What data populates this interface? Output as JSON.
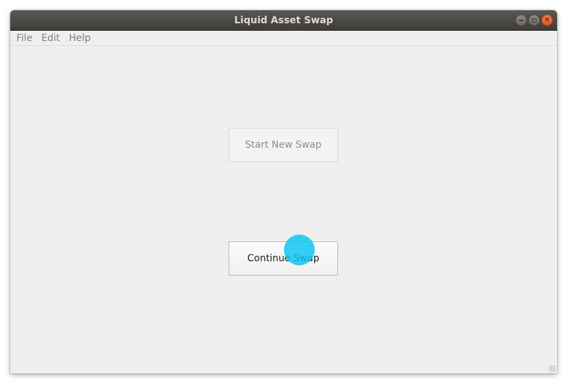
{
  "window": {
    "title": "Liquid Asset Swap"
  },
  "menu": {
    "items": [
      {
        "label": "File"
      },
      {
        "label": "Edit"
      },
      {
        "label": "Help"
      }
    ]
  },
  "main": {
    "start_new_swap_label": "Start New Swap",
    "start_new_swap_state": "disabled",
    "continue_swap_label": "Continue Swap",
    "continue_swap_state": "enabled"
  },
  "icons": {
    "minimize": "minimize-icon",
    "maximize": "maximize-icon",
    "close": "close-icon",
    "resize_grip": "resize-grip-icon"
  },
  "colors": {
    "titlebar": "#4a4945",
    "close_button": "#e95e34",
    "window_bg": "#efefef",
    "touch_indicator": "#08c4f2"
  }
}
